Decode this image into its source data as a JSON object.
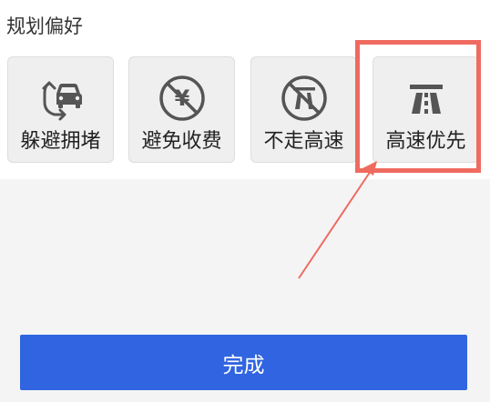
{
  "section": {
    "title": "规划偏好"
  },
  "options": [
    {
      "label": "躲避拥堵",
      "icon": "avoid-congestion-icon"
    },
    {
      "label": "避免收费",
      "icon": "avoid-toll-icon"
    },
    {
      "label": "不走高速",
      "icon": "no-highway-icon"
    },
    {
      "label": "高速优先",
      "icon": "highway-icon"
    }
  ],
  "done_button": {
    "label": "完成"
  },
  "colors": {
    "card_background": "#efefef",
    "icon_color": "#555555",
    "button_background": "#3064e0",
    "annotation_red": "#ef6b60",
    "bottom_background": "#f4f4f4"
  }
}
